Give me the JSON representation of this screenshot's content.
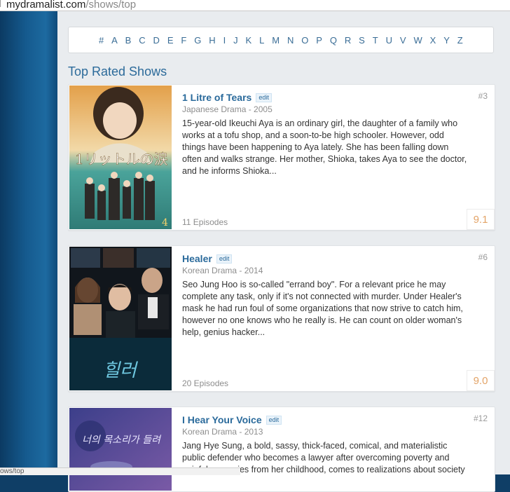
{
  "browser": {
    "url_host": "mydramalist.com",
    "url_path": "/shows/top"
  },
  "status_bar": {
    "text": "ows/top"
  },
  "alphabet": [
    "#",
    "A",
    "B",
    "C",
    "D",
    "E",
    "F",
    "G",
    "H",
    "I",
    "J",
    "K",
    "L",
    "M",
    "N",
    "O",
    "P",
    "Q",
    "R",
    "S",
    "T",
    "U",
    "V",
    "W",
    "X",
    "Y",
    "Z"
  ],
  "section_title": "Top Rated Shows",
  "shows": [
    {
      "title": "1 Litre of Tears",
      "edit_label": "edit",
      "meta": "Japanese Drama - 2005",
      "rank": "#3",
      "description": "15-year-old Ikeuchi Aya is an ordinary girl, the daughter of a family who works at a tofu shop, and a soon-to-be high schooler. However, odd things have been happening to Aya lately. She has been falling down often and walks strange. Her mother, Shioka, takes Aya to see the doctor, and he informs Shioka...",
      "episodes": "11 Episodes",
      "score": "9.1",
      "poster_text": "1リットルの涙"
    },
    {
      "title": "Healer",
      "edit_label": "edit",
      "meta": "Korean Drama - 2014",
      "rank": "#6",
      "description": "Seo Jung Hoo is so-called \"errand boy\". For a relevant price he may complete any task, only if it's not connected with murder. Under Healer's mask he had run foul of some organizations that now strive to catch him, however no one knows who he really is. He can count on older woman's help, genius hacker...",
      "episodes": "20 Episodes",
      "score": "9.0",
      "poster_text": "힐러"
    },
    {
      "title": "I Hear Your Voice",
      "edit_label": "edit",
      "meta": "Korean Drama - 2013",
      "rank": "#12",
      "description": "Jang Hye Sung, a bold, sassy, thick-faced, comical, and materialistic public defender who becomes a lawyer after overcoming poverty and painful memories from her childhood, comes to realizations about society",
      "episodes": "",
      "score": "",
      "poster_text": "너의 목소리가 들려"
    }
  ]
}
